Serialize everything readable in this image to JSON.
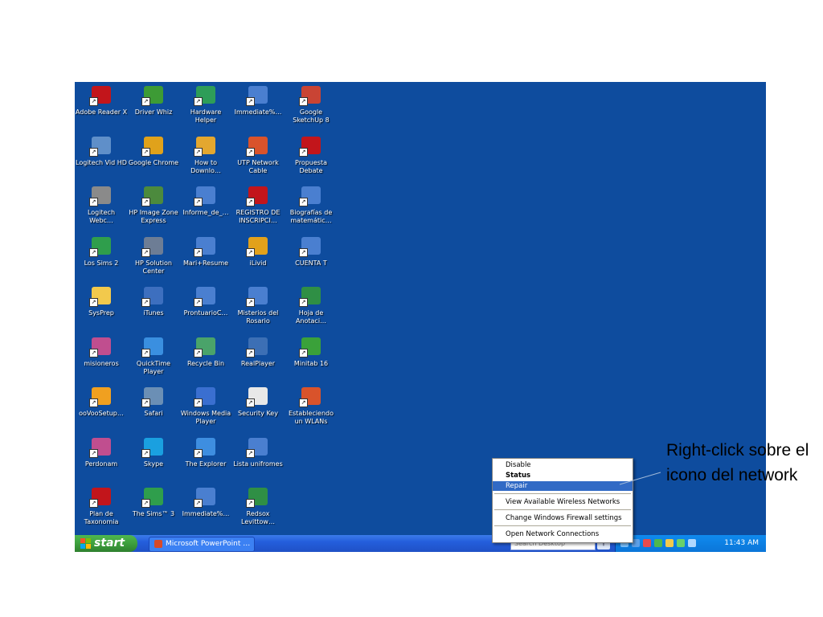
{
  "desktop": {
    "icons": [
      {
        "label": "Adobe Reader X",
        "icon": "adobe-pdf-icon",
        "color": "#c2151b"
      },
      {
        "label": "Driver Whiz",
        "icon": "driver-whiz-icon",
        "color": "#3d9b35"
      },
      {
        "label": "Hardware Helper",
        "icon": "hardware-helper-icon",
        "color": "#2e9d58"
      },
      {
        "label": "Immediate%…",
        "icon": "word-document-icon",
        "color": "#4a7fd0"
      },
      {
        "label": "Google SketchUp 8",
        "icon": "sketchup-icon",
        "color": "#c94434"
      },
      {
        "label": "Logitech Vid HD",
        "icon": "logitech-vid-icon",
        "color": "#5f8fc9"
      },
      {
        "label": "Google Chrome",
        "icon": "chrome-icon",
        "color": "#e0a21b"
      },
      {
        "label": "How to Downlo…",
        "icon": "document-icon",
        "color": "#e3a72f"
      },
      {
        "label": "UTP Network Cable",
        "icon": "powerpoint-document-icon",
        "color": "#d9532b"
      },
      {
        "label": "Propuesta Debate",
        "icon": "pdf-document-icon",
        "color": "#c2151b"
      },
      {
        "label": "Logitech Webc…",
        "icon": "webcam-icon",
        "color": "#8a8a8a"
      },
      {
        "label": "HP Image Zone Express",
        "icon": "hp-image-zone-icon",
        "color": "#4c8a3d"
      },
      {
        "label": "Informe_de_…",
        "icon": "word-document-icon",
        "color": "#4a7fd0"
      },
      {
        "label": "REGISTRO DE INSCRIPCI…",
        "icon": "pdf-document-icon",
        "color": "#c2151b"
      },
      {
        "label": "Biografías de matemátic…",
        "icon": "word-document-icon",
        "color": "#4a7fd0"
      },
      {
        "label": "Los Sims 2",
        "icon": "sims-icon",
        "color": "#2f9e4c"
      },
      {
        "label": "HP Solution Center",
        "icon": "hp-solution-center-icon",
        "color": "#6d7d95"
      },
      {
        "label": "Mari+Resume",
        "icon": "word-document-icon",
        "color": "#4a7fd0"
      },
      {
        "label": "iLivid",
        "icon": "ilivid-icon",
        "color": "#e2a11b"
      },
      {
        "label": "CUENTA T",
        "icon": "word-document-icon",
        "color": "#4a7fd0"
      },
      {
        "label": "SysPrep",
        "icon": "folder-icon",
        "color": "#f2c94c"
      },
      {
        "label": "iTunes",
        "icon": "itunes-icon",
        "color": "#3d6fbf"
      },
      {
        "label": "ProntuarioC…",
        "icon": "word-document-icon",
        "color": "#4a7fd0"
      },
      {
        "label": "Misterios del Rosario",
        "icon": "word-document-icon",
        "color": "#4a7fd0"
      },
      {
        "label": "Hoja de Anotaci…",
        "icon": "excel-document-icon",
        "color": "#2f8f45"
      },
      {
        "label": "misioneros",
        "icon": "diamond-app-icon",
        "color": "#c04e8f"
      },
      {
        "label": "QuickTime Player",
        "icon": "quicktime-icon",
        "color": "#3a8fe0"
      },
      {
        "label": "Recycle Bin",
        "icon": "recycle-bin-icon",
        "color": "#4aa36a"
      },
      {
        "label": "RealPlayer",
        "icon": "realplayer-icon",
        "color": "#3c6fb5"
      },
      {
        "label": "Minitab 16",
        "icon": "minitab-icon",
        "color": "#3aa13a"
      },
      {
        "label": "ooVooSetup…",
        "icon": "oovoo-icon",
        "color": "#f0a020"
      },
      {
        "label": "Safari",
        "icon": "safari-icon",
        "color": "#6b8fb5"
      },
      {
        "label": "Windows Media Player",
        "icon": "windows-media-player-icon",
        "color": "#3a6fd0"
      },
      {
        "label": "Security Key",
        "icon": "text-document-icon",
        "color": "#e8e8e8"
      },
      {
        "label": "Estableciendo un WLANs",
        "icon": "powerpoint-document-icon",
        "color": "#d9532b"
      },
      {
        "label": "Perdonam",
        "icon": "diamond-app-icon",
        "color": "#c04e8f"
      },
      {
        "label": "Skype",
        "icon": "skype-icon",
        "color": "#1aa0e0"
      },
      {
        "label": "The Explorer",
        "icon": "internet-explorer-icon",
        "color": "#3e8ee0"
      },
      {
        "label": "Lista unifromes",
        "icon": "word-document-icon",
        "color": "#4a7fd0"
      },
      {
        "label": "",
        "icon": "",
        "color": ""
      },
      {
        "label": "Plan de Taxonomia",
        "icon": "pdf-document-icon",
        "color": "#c2151b"
      },
      {
        "label": "The Sims™ 3",
        "icon": "sims-icon",
        "color": "#2f9e4c"
      },
      {
        "label": "Immediate%…",
        "icon": "word-document-icon",
        "color": "#4a7fd0"
      },
      {
        "label": "Redsox Levittow…",
        "icon": "excel-document-icon",
        "color": "#2f8f45"
      }
    ]
  },
  "context_menu": {
    "items": [
      {
        "label": "Disable",
        "style": "normal"
      },
      {
        "label": "Status",
        "style": "bold"
      },
      {
        "label": "Repair",
        "style": "highlight"
      },
      {
        "label": "View Available Wireless Networks",
        "style": "normal"
      },
      {
        "label": "Change Windows Firewall settings",
        "style": "normal"
      },
      {
        "label": "Open Network Connections",
        "style": "normal"
      }
    ]
  },
  "taskbar": {
    "start_label": "start",
    "app_label": "Microsoft PowerPoint …",
    "search_placeholder": "Search Desktop",
    "clock": "11:43 AM"
  },
  "annotation": {
    "text": "Right-click sobre el icono del network"
  },
  "colors": {
    "desktop": "#0e4c9e",
    "menu_highlight": "#316ac5",
    "start_green": "#3a9a3a"
  }
}
